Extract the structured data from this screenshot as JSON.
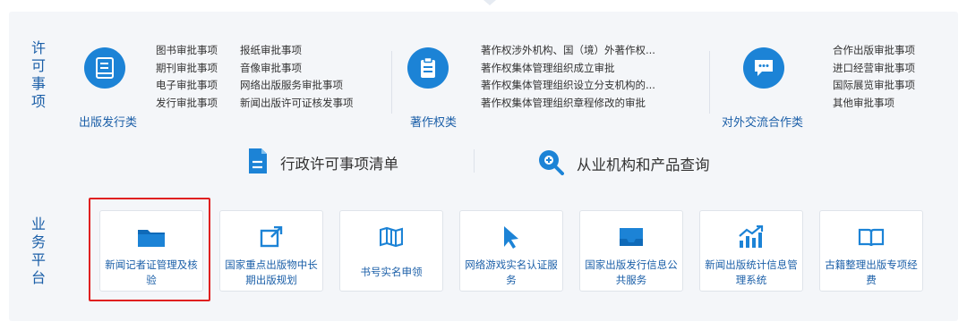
{
  "licensing": {
    "label": [
      "许",
      "可",
      "事",
      "项"
    ],
    "categories": [
      {
        "label": "出版发行类",
        "icon": "book-icon",
        "col1": [
          "图书审批事项",
          "期刊审批事项",
          "电子审批事项",
          "发行审批事项"
        ],
        "col2": [
          "报纸审批事项",
          "音像审批事项",
          "网络出版服务审批事项",
          "新闻出版许可证核发事项"
        ]
      },
      {
        "label": "著作权类",
        "icon": "clipboard-icon",
        "col1": [
          "著作权涉外机构、国（境）外著作权...",
          "著作权集体管理组织成立审批",
          "著作权集体管理组织设立分支机构的...",
          "著作权集体管理组织章程修改的审批"
        ]
      },
      {
        "label": "对外交流合作类",
        "icon": "chat-icon",
        "col1": [
          "合作出版审批事项",
          "进口经营审批事项",
          "国际展览审批事项",
          "其他审批事项"
        ]
      }
    ]
  },
  "quick_links": [
    {
      "label": "行政许可事项清单",
      "icon": "document-icon"
    },
    {
      "label": "从业机构和产品查询",
      "icon": "search-icon"
    }
  ],
  "platform": {
    "label": [
      "业",
      "务",
      "平",
      "台"
    ],
    "tiles": [
      {
        "label": "新闻记者证管理及核验",
        "icon": "folder-icon"
      },
      {
        "label": "国家重点出版物中长期出版规划",
        "icon": "external-link-icon"
      },
      {
        "label": "书号实名申领",
        "icon": "map-icon"
      },
      {
        "label": "网络游戏实名认证服务",
        "icon": "cursor-icon"
      },
      {
        "label": "国家出版发行信息公共服务",
        "icon": "inbox-icon"
      },
      {
        "label": "新闻出版统计信息管理系统",
        "icon": "chart-icon"
      },
      {
        "label": "古籍整理出版专项经费",
        "icon": "open-book-icon"
      }
    ]
  },
  "colors": {
    "accent": "#1c83d6",
    "text_blue": "#1b5fa8",
    "highlight": "#e02020",
    "panel": "#f4f6f9"
  }
}
